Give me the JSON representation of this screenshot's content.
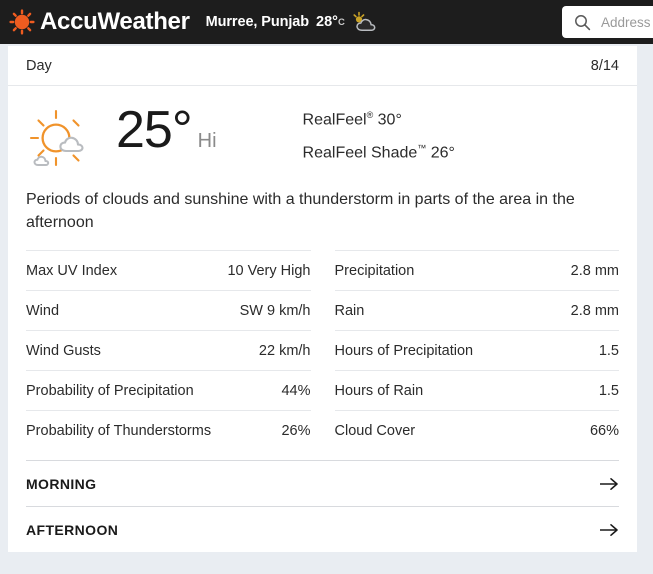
{
  "topbar": {
    "brand_name": "AccuWeather",
    "logo_icon": "sun-logo-icon",
    "location_name": "Murree, Punjab",
    "location_temp": "28°",
    "location_unit": "C",
    "location_icon": "partly-cloudy-icon",
    "search": {
      "icon": "search-icon",
      "placeholder": "Address"
    },
    "colors": {
      "bar_background": "#1d1d1d",
      "brand_orange": "#ef5c20"
    }
  },
  "card": {
    "day_header": {
      "label": "Day",
      "date": "8/14"
    },
    "hero": {
      "weather_icon": "sun-behind-cloud-icon",
      "temperature": "25°",
      "temperature_qualifier": "Hi",
      "realfeel_label": "RealFeel",
      "realfeel_sup": "®",
      "realfeel_value": "30°",
      "realfeel_shade_label": "RealFeel Shade",
      "realfeel_shade_sup": "™",
      "realfeel_shade_value": "26°"
    },
    "phrase": "Periods of clouds and sunshine with a thunderstorm in parts of the area in the afternoon",
    "metrics_left": [
      {
        "label": "Max UV Index",
        "value": "10 Very High"
      },
      {
        "label": "Wind",
        "value": "SW 9 km/h"
      },
      {
        "label": "Wind Gusts",
        "value": "22 km/h"
      },
      {
        "label": "Probability of Precipitation",
        "value": "44%"
      },
      {
        "label": "Probability of Thunderstorms",
        "value": "26%"
      }
    ],
    "metrics_right": [
      {
        "label": "Precipitation",
        "value": "2.8 mm"
      },
      {
        "label": "Rain",
        "value": "2.8 mm"
      },
      {
        "label": "Hours of Precipitation",
        "value": "1.5"
      },
      {
        "label": "Hours of Rain",
        "value": "1.5"
      },
      {
        "label": "Cloud Cover",
        "value": "66%"
      }
    ],
    "periods": [
      {
        "label": "MORNING",
        "arrow": "arrow-right-icon"
      },
      {
        "label": "AFTERNOON",
        "arrow": "arrow-right-icon"
      }
    ]
  }
}
